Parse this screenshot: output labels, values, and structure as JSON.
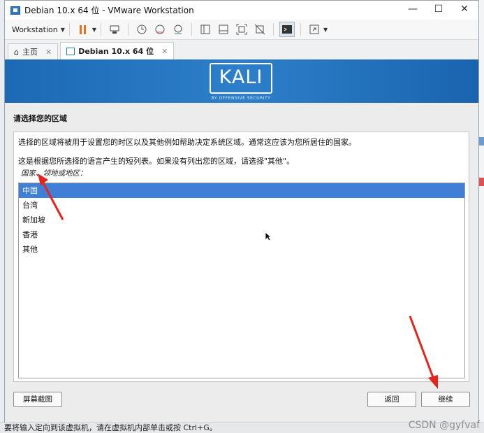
{
  "window": {
    "title": "Debian 10.x 64 位 - VMware Workstation",
    "controls": {
      "minimize": "—",
      "maximize": "☐",
      "close": "✕"
    }
  },
  "toolbar": {
    "menu_label": "Workstation",
    "icons": [
      "pause-icon",
      "send-keys-icon",
      "snapshot-icon",
      "revert-snapshot-icon",
      "snapshot-manager-icon",
      "library-icon",
      "thumbnail-icon",
      "fit-guest-icon",
      "unity-icon",
      "console-icon",
      "fullscreen-icon"
    ]
  },
  "tabs": [
    {
      "label": "主页",
      "icon": "home-icon"
    },
    {
      "label": "Debian 10.x 64 位",
      "icon": "vm-icon"
    }
  ],
  "installer": {
    "brand": "KALI",
    "brand_sub": "BY OFFENSIVE SECURITY",
    "step_title": "请选择您的区域",
    "description_1": "选择的区域将被用于设置您的时区以及其他例如帮助决定系统区域。通常这应该为您所居住的国家。",
    "description_2": "这是根据您所选择的语言产生的短列表。如果没有列出您的区域，请选择\"其他\"。",
    "list_label": "国家、领地或地区：",
    "options": [
      "中国",
      "台湾",
      "新加坡",
      "香港",
      "其他"
    ],
    "selected_index": 0,
    "buttons": {
      "screenshot": "屏幕截图",
      "back": "返回",
      "continue": "继续"
    }
  },
  "statusbar": {
    "text": "要将输入定向到该虚拟机，请在虚拟机内部单击或按 Ctrl+G。",
    "watermark": "CSDN @gyfvaf"
  },
  "colors": {
    "accent": "#3f7fd6",
    "banner": "#2371bd",
    "arrow": "#e8231c"
  }
}
